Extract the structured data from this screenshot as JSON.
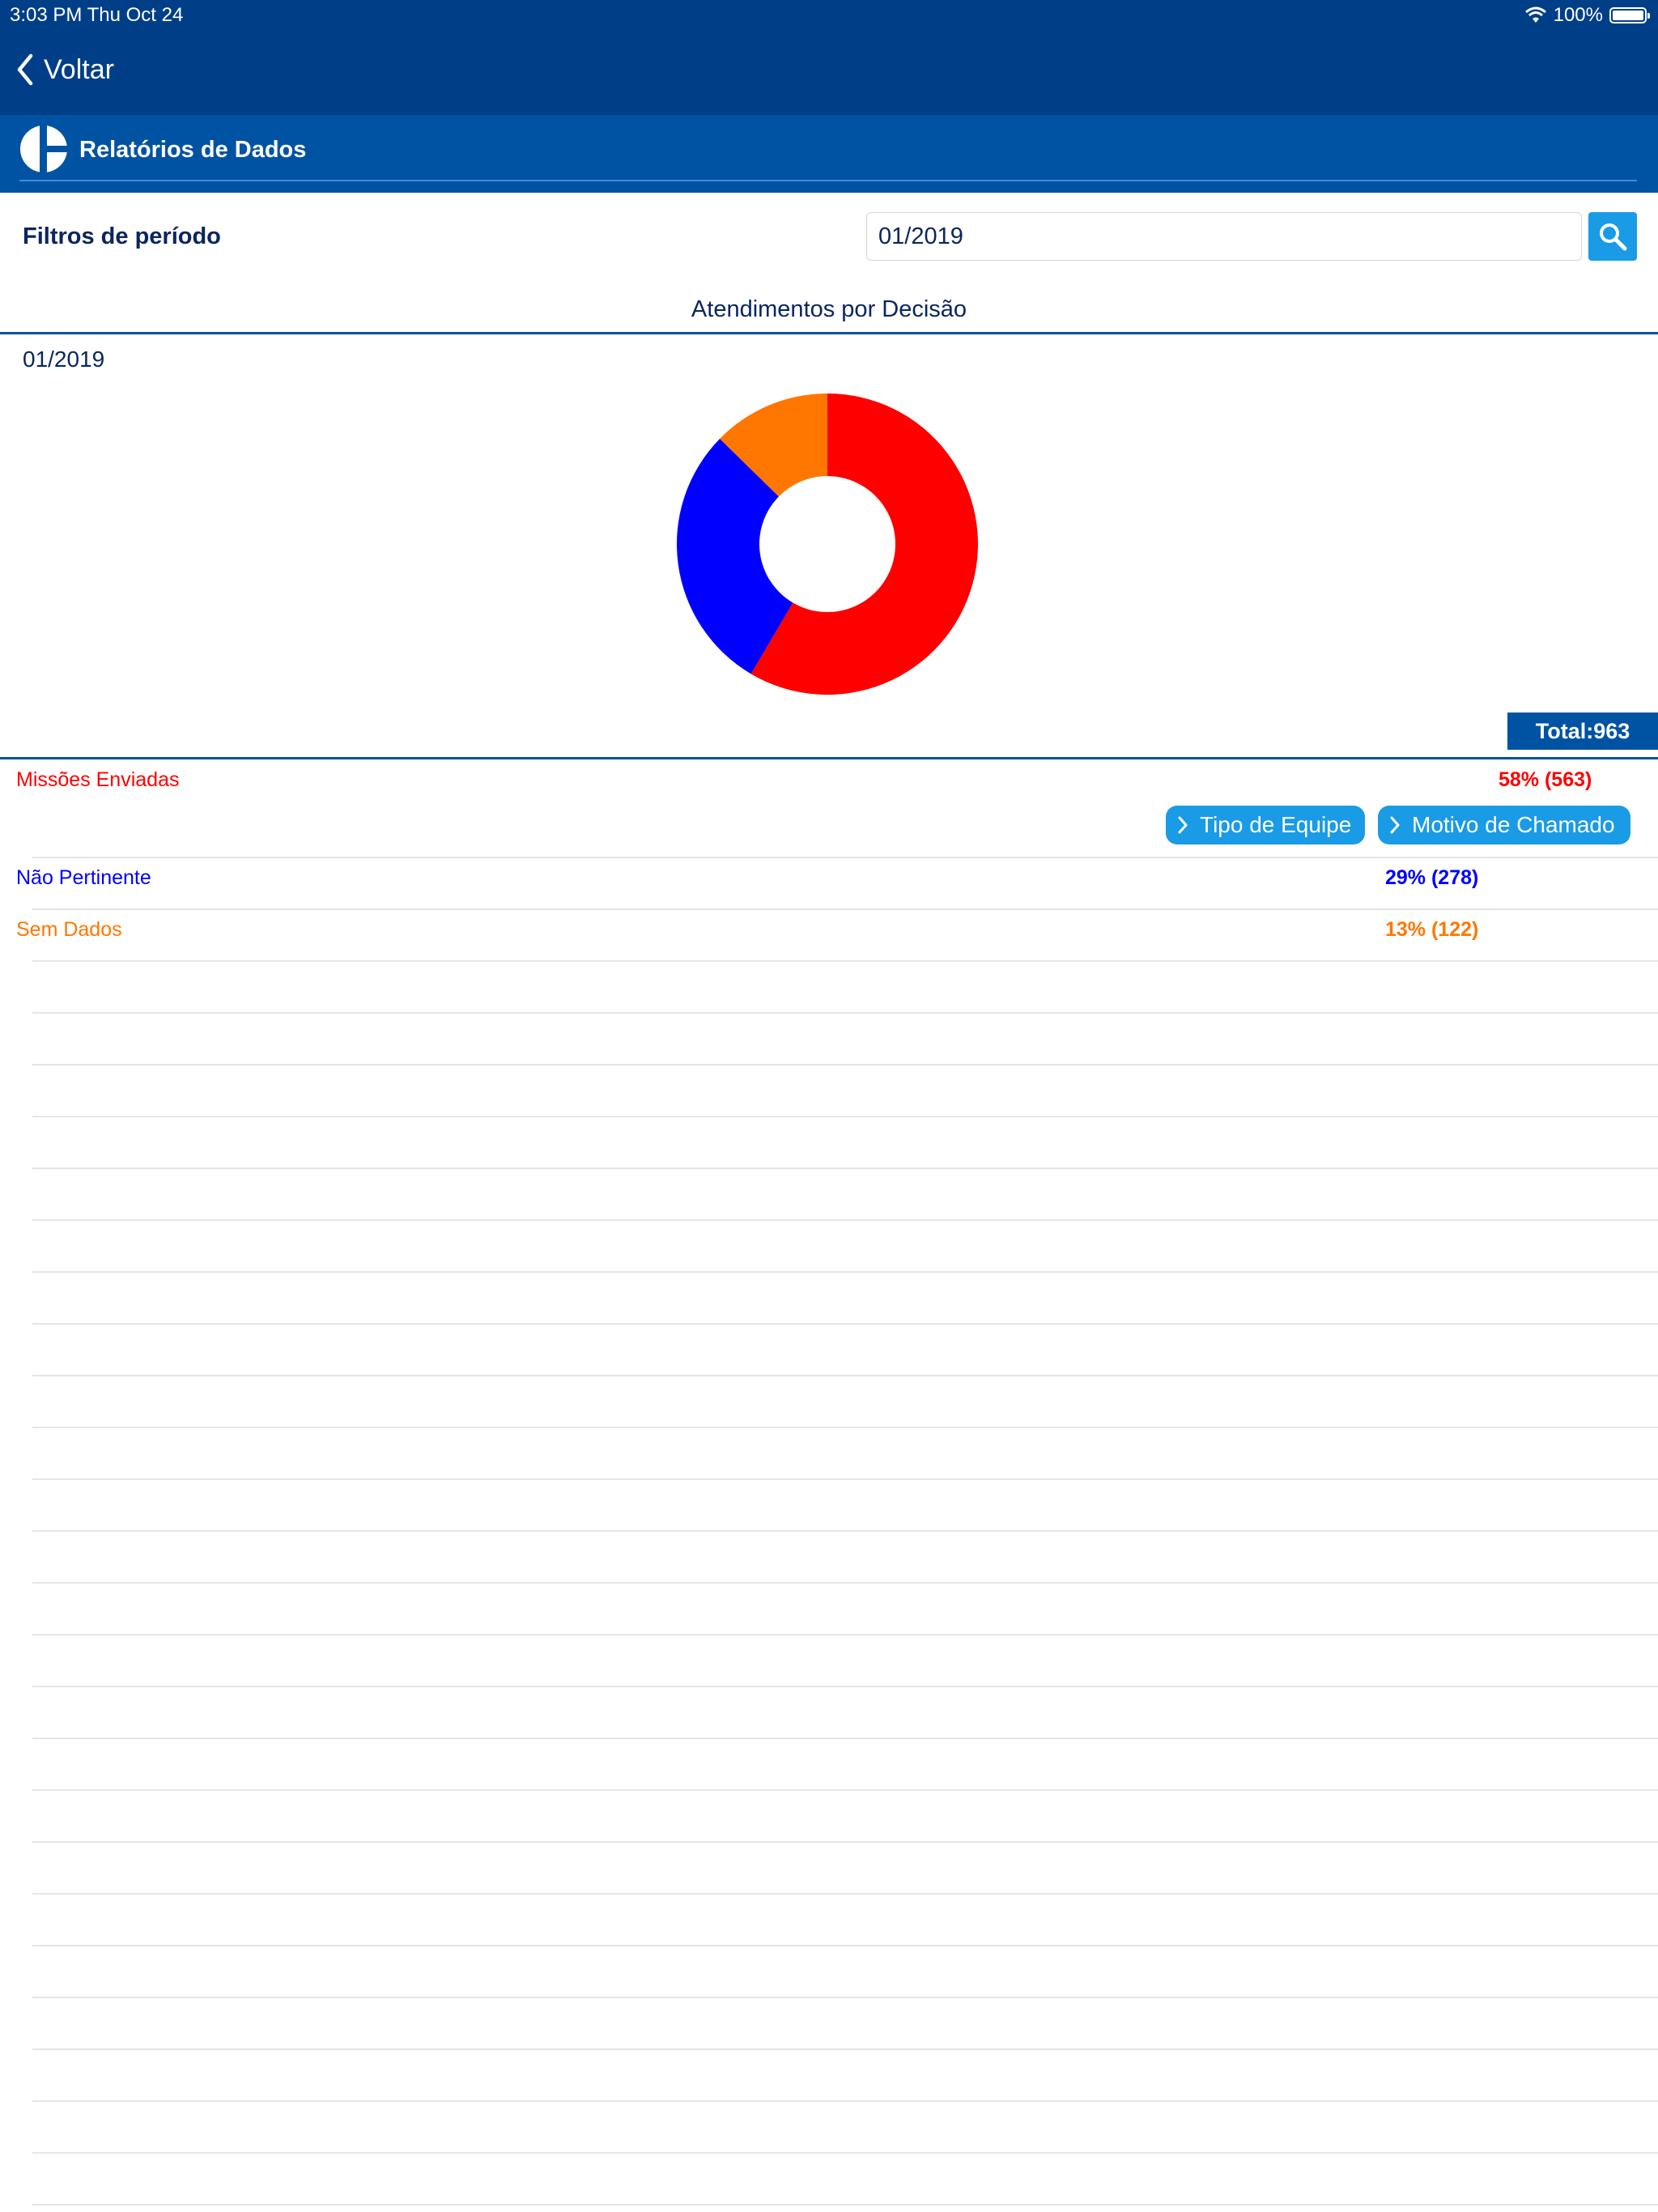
{
  "status_bar": {
    "time": "3:03 PM   Thu Oct 24",
    "battery": "100%"
  },
  "nav": {
    "back_label": "Voltar"
  },
  "header": {
    "title": "Relatórios de Dados"
  },
  "filter": {
    "label": "Filtros de período",
    "value": "01/2019"
  },
  "chart": {
    "title": "Atendimentos por Decisão",
    "period": "01/2019",
    "total_label": "Total:963"
  },
  "chart_data": {
    "type": "pie",
    "title": "Atendimentos por Decisão",
    "categories": [
      "Missões Enviadas",
      "Não Pertinente",
      "Sem Dados"
    ],
    "values": [
      563,
      278,
      122
    ],
    "percent": [
      58,
      29,
      13
    ],
    "colors": [
      "#ff0000",
      "#0000ff",
      "#ff7700"
    ],
    "total": 963,
    "donut": true
  },
  "legend": [
    {
      "label": "Missões Enviadas",
      "value": "58% (563)",
      "color": "#ff0000"
    },
    {
      "label": "Não Pertinente",
      "value": "29% (278)",
      "color": "#0000ff"
    },
    {
      "label": "Sem Dados",
      "value": "13% (122)",
      "color": "#ff7700"
    }
  ],
  "actions": {
    "tipo_equipe": "Tipo de Equipe",
    "motivo_chamado": "Motivo de Chamado"
  },
  "icons": [
    "chevron-left-icon",
    "wifi-icon",
    "battery-icon",
    "search-icon",
    "chevron-right-icon",
    "logo-icon"
  ]
}
